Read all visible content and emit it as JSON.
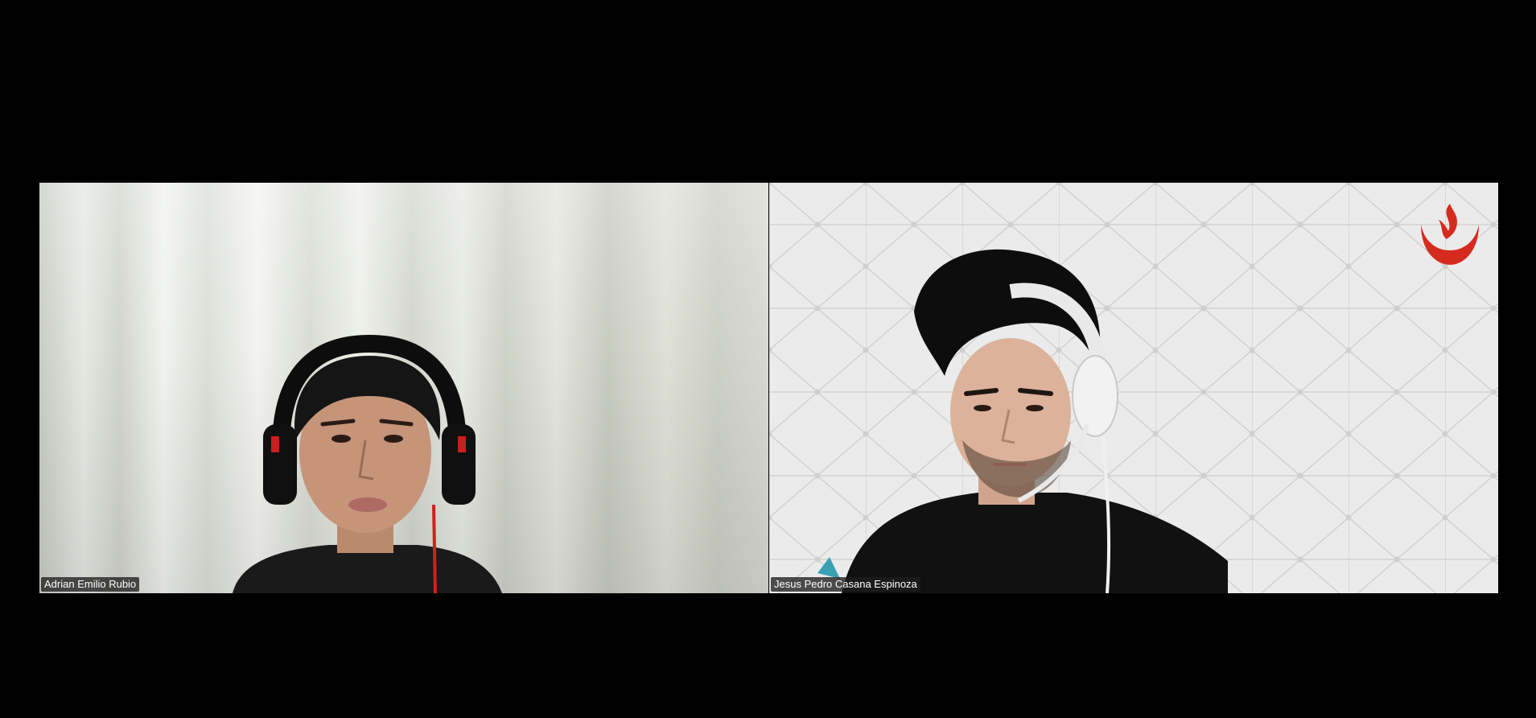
{
  "participants": [
    {
      "name": "Adrian Emilio Rubio"
    },
    {
      "name": "Jesus Pedro Casana Espinoza"
    }
  ],
  "colors": {
    "background": "#000000",
    "name_tag_bg": "#1e1e1e",
    "name_tag_text": "#ffffff",
    "logo_red": "#d52b1e"
  },
  "icons": {
    "logo": "university-flame-logo"
  }
}
